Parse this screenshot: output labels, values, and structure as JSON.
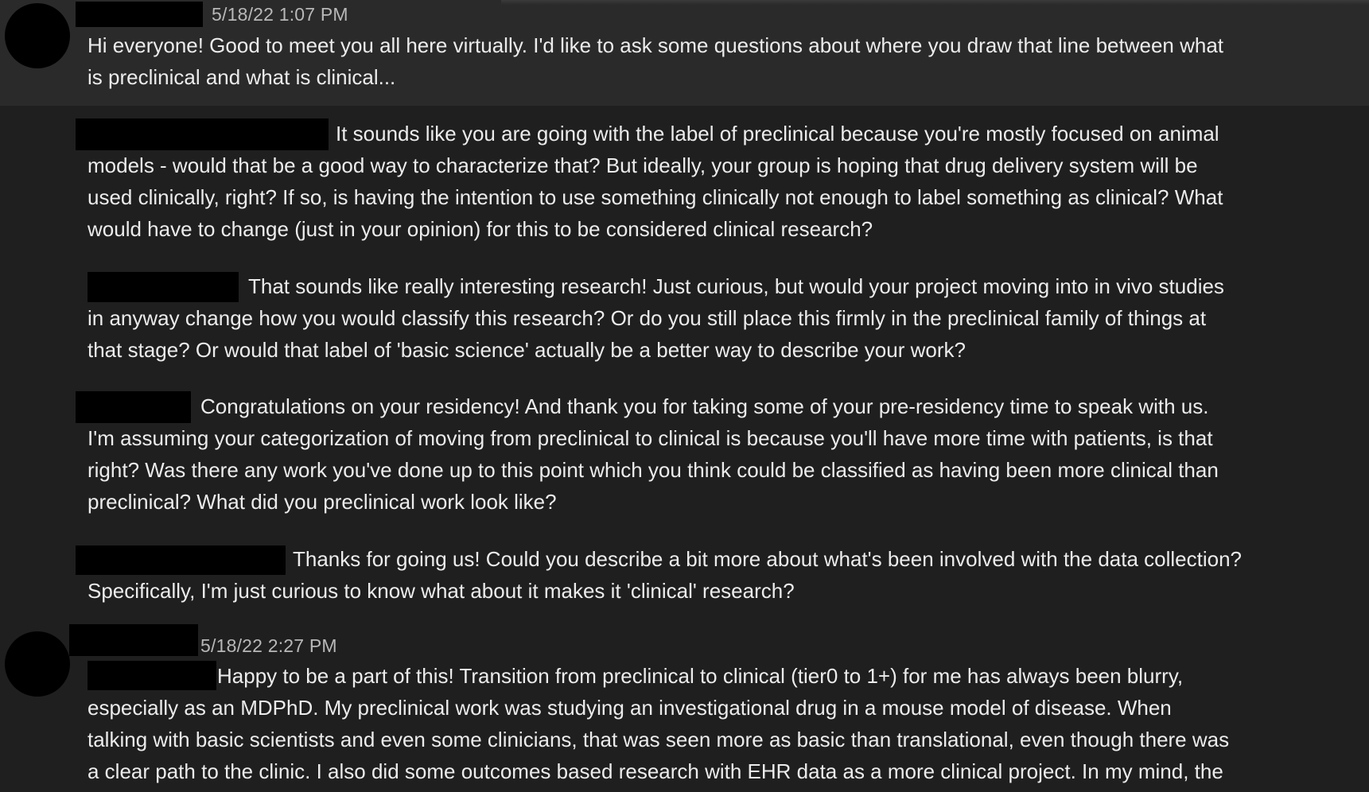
{
  "messages": [
    {
      "timestamp": "5/18/22 1:07 PM",
      "lines": [
        "Hi everyone! Good to meet you all here virtually. I'd like to ask some questions about where you draw that line between what",
        "is preclinical and what is clinical..."
      ]
    },
    {
      "lines": [
        "It sounds like you are going with the label of preclinical because you're mostly focused on animal",
        "models - would that be a good way to characterize that? But ideally, your group is hoping that drug delivery system will be",
        "used clinically, right? If so, is having the intention to use something clinically not enough to label something as clinical? What",
        "would have to change (just in your opinion) for this to be considered clinical research?"
      ]
    },
    {
      "lines": [
        "That sounds like really interesting research! Just curious, but would your project moving into in vivo studies",
        "in anyway change how you would classify this research? Or do you still place this firmly in the preclinical family of things at",
        "that stage? Or would that label of 'basic science' actually be a better way to describe your work?"
      ]
    },
    {
      "lines": [
        "Congratulations on your residency! And thank you for taking some of your pre-residency time to speak with us.",
        "I'm assuming your categorization of moving from preclinical to clinical is because you'll have more time with patients, is that",
        "right? Was there any work you've done up to this point which you think could be classified as having been more clinical than",
        "preclinical? What did you preclinical work look like?"
      ]
    },
    {
      "lines": [
        "Thanks for going us! Could you describe a bit more about what's been involved with the data collection?",
        "Specifically, I'm just curious to know what about it makes it 'clinical' research?"
      ]
    },
    {
      "timestamp": "5/18/22 2:27 PM",
      "lines": [
        "Happy to be a part of this! Transition from preclinical to clinical (tier0 to 1+) for me has always been blurry,",
        "especially as an MDPhD. My preclinical work was studying an investigational drug in a mouse model of disease. When",
        "talking with basic scientists and even some clinicians, that was seen more as basic than translational, even though there was",
        "a clear path to the clinic. I also did some outcomes based research with EHR data as a more clinical project. In my mind, the"
      ]
    }
  ]
}
